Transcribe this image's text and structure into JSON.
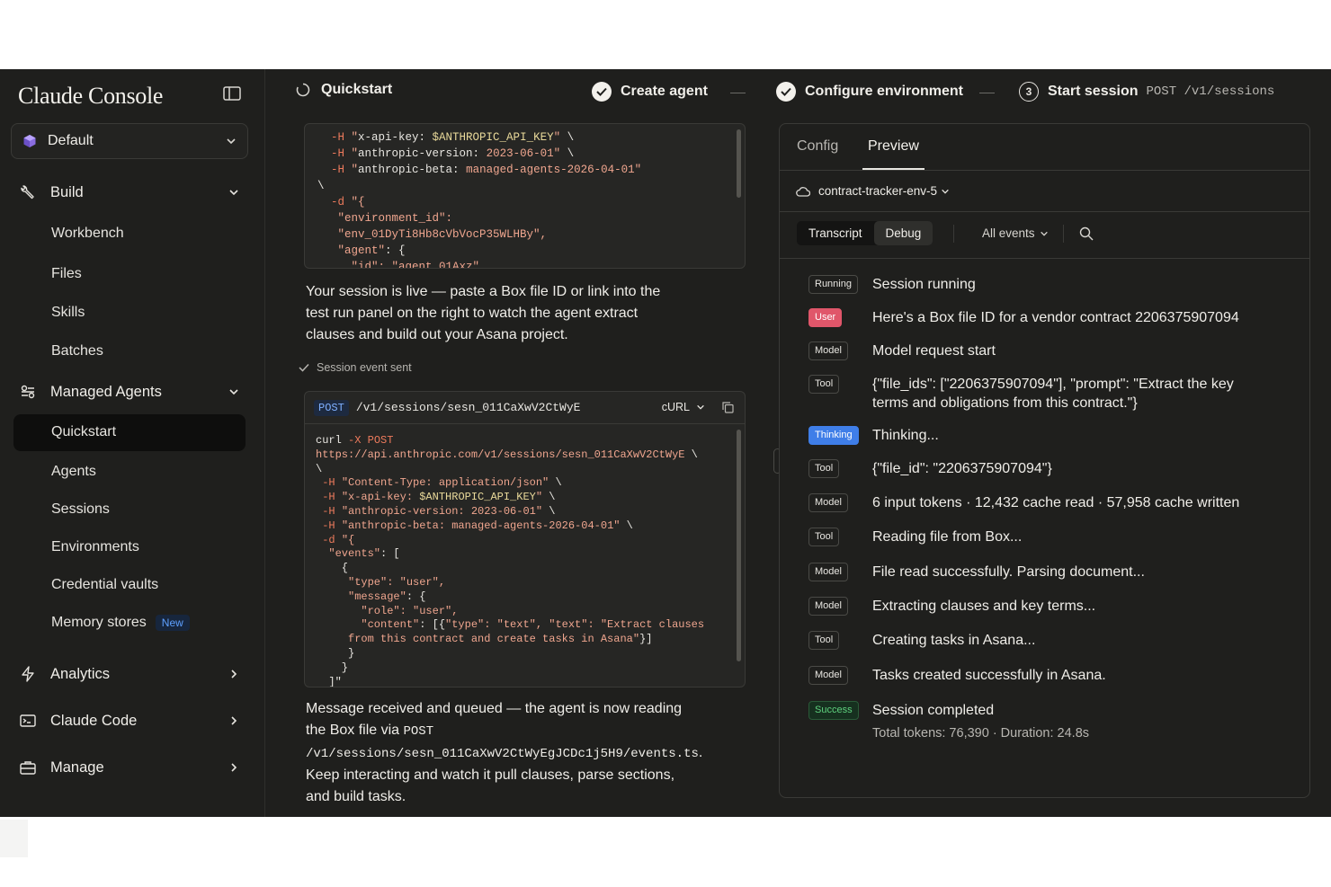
{
  "sidebar": {
    "brand": "Claude Console",
    "org": "Default",
    "groups": {
      "build": "Build",
      "managed_agents": "Managed Agents",
      "analytics": "Analytics",
      "claude_code": "Claude Code",
      "manage": "Manage"
    },
    "build_items": [
      "Workbench",
      "Files",
      "Skills",
      "Batches"
    ],
    "agent_items": [
      "Quickstart",
      "Agents",
      "Sessions",
      "Environments",
      "Credential vaults",
      "Memory stores"
    ],
    "new_badge": "New"
  },
  "stepper": {
    "quickstart": "Quickstart",
    "step1": "Create agent",
    "step2": "Configure environment",
    "step3_num": "3",
    "step3": "Start session",
    "step3_endpoint": "POST /v1/sessions"
  },
  "main": {
    "para1": "Your session is live — paste a Box file ID or link into the test run panel on the right to watch the agent extract clauses and build out your Asana project.",
    "event_sent": "Session event sent",
    "req_method": "POST",
    "req_path": "/v1/sessions/sesn_011CaXwV2CtWyE",
    "lang": "cURL",
    "para2_a": "Message received and queued — the agent is now reading the Box file via ",
    "para2_code1": "POST /v1/sessions/sesn_011CaXwV2CtWyEgJCDc1j5H9/events.ts",
    "para2_b": ". Keep interacting and watch it pull clauses, parse sections, and build tasks."
  },
  "panel": {
    "tabs": [
      "Config",
      "Preview"
    ],
    "env": "contract-tracker-env-5",
    "seg": [
      "Transcript",
      "Debug"
    ],
    "filter": "All events",
    "events": [
      {
        "tag": "Running",
        "text": "Session running"
      },
      {
        "tag": "User",
        "text": "Here's a Box file ID for a vendor contract 2206375907094"
      },
      {
        "tag": "Model",
        "text": "Model request start"
      },
      {
        "tag": "Tool",
        "text": "{\"file_ids\": [\"2206375907094\"], \"prompt\": \"Extract the key terms and obligations from this contract.\"}"
      },
      {
        "tag": "Thinking",
        "text": "Thinking..."
      },
      {
        "tag": "Tool",
        "text": "{\"file_id\": \"2206375907094\"}"
      },
      {
        "tag": "Model",
        "text": "6 input tokens · 12,432 cache read · 57,958 cache written"
      },
      {
        "tag": "Tool",
        "text": "Reading file from Box..."
      },
      {
        "tag": "Model",
        "text": "File read successfully. Parsing document..."
      },
      {
        "tag": "Model",
        "text": "Extracting clauses and key terms..."
      },
      {
        "tag": "Tool",
        "text": "Creating tasks in Asana..."
      },
      {
        "tag": "Model",
        "text": "Tasks created successfully in Asana."
      },
      {
        "tag": "Success",
        "text": "Session completed"
      }
    ],
    "summary": "Total tokens: 76,390 · Duration: 24.8s"
  },
  "colors": {
    "background": "#1f1f1d",
    "user_tag": "#e0566a",
    "thinking_tag": "#3f7ee8",
    "success_tag": "#5fd17e",
    "code_operator": "#ec7a5c"
  }
}
